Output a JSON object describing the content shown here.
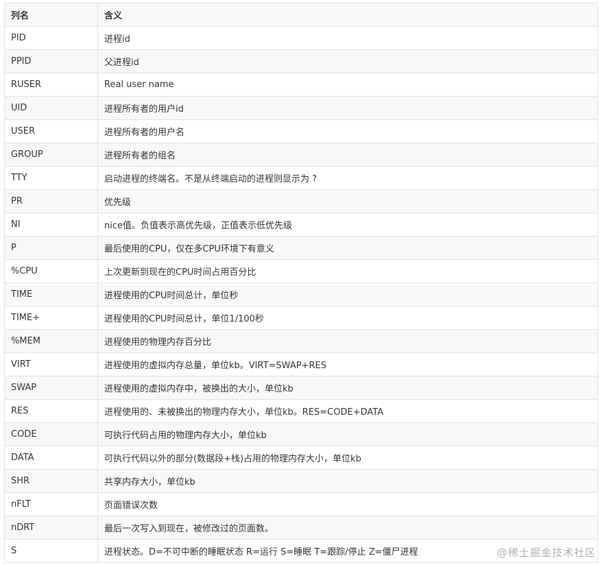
{
  "table": {
    "headers": [
      "列名",
      "含义"
    ],
    "rows": [
      [
        "PID",
        "进程id"
      ],
      [
        "PPID",
        "父进程id"
      ],
      [
        "RUSER",
        "Real user name"
      ],
      [
        "UID",
        "进程所有者的用户id"
      ],
      [
        "USER",
        "进程所有者的用户名"
      ],
      [
        "GROUP",
        "进程所有者的组名"
      ],
      [
        "TTY",
        "启动进程的终端名。不是从终端启动的进程则显示为 ?"
      ],
      [
        "PR",
        "优先级"
      ],
      [
        "NI",
        "nice值。负值表示高优先级，正值表示低优先级"
      ],
      [
        "P",
        "最后使用的CPU，仅在多CPU环境下有意义"
      ],
      [
        "%CPU",
        "上次更新到现在的CPU时间占用百分比"
      ],
      [
        "TIME",
        "进程使用的CPU时间总计，单位秒"
      ],
      [
        "TIME+",
        "进程使用的CPU时间总计，单位1/100秒"
      ],
      [
        "%MEM",
        "进程使用的物理内存百分比"
      ],
      [
        "VIRT",
        "进程使用的虚拟内存总量，单位kb。VIRT=SWAP+RES"
      ],
      [
        "SWAP",
        "进程使用的虚拟内存中，被换出的大小，单位kb"
      ],
      [
        "RES",
        "进程使用的、未被换出的物理内存大小，单位kb。RES=CODE+DATA"
      ],
      [
        "CODE",
        "可执行代码占用的物理内存大小，单位kb"
      ],
      [
        "DATA",
        "可执行代码以外的部分(数据段+栈)占用的物理内存大小，单位kb"
      ],
      [
        "SHR",
        "共享内存大小，单位kb"
      ],
      [
        "nFLT",
        "页面错误次数"
      ],
      [
        "nDRT",
        "最后一次写入到现在，被修改过的页面数。"
      ],
      [
        "S",
        "进程状态。D=不可中断的睡眠状态 R=运行 S=睡眠 T=跟踪/停止 Z=僵尸进程"
      ]
    ]
  },
  "watermark": "@稀土掘金技术社区"
}
